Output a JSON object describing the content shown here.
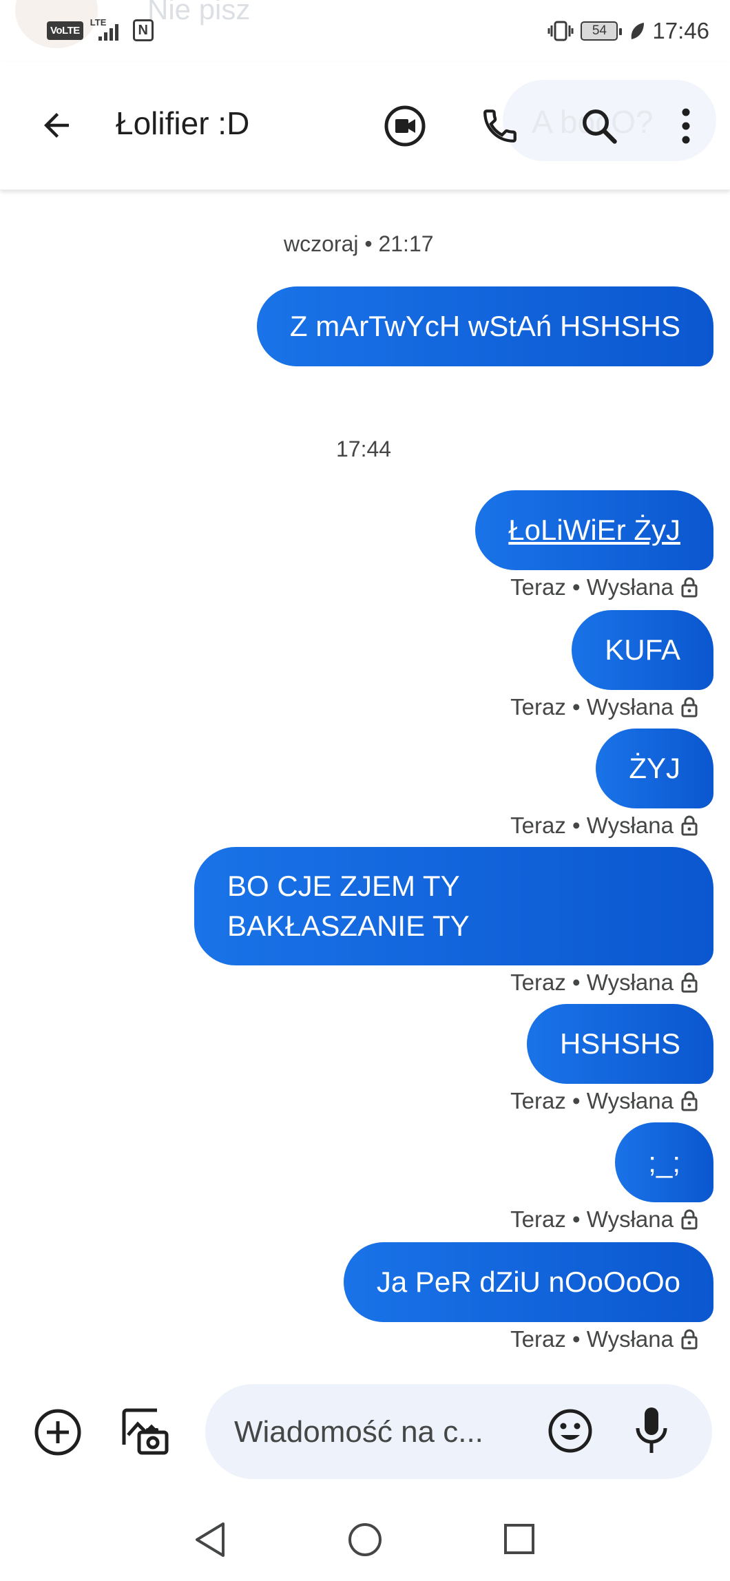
{
  "status_bar": {
    "background_notification_text": "Nie pisz",
    "volte": "VoLTE",
    "lte": "LTE",
    "nfc": "N",
    "battery": "54",
    "time": "17:46"
  },
  "header": {
    "title": "Łolifier :D",
    "background_hint_text": "A bocO?",
    "icons": [
      "arrow-back-icon",
      "video-call-icon",
      "phone-icon",
      "search-icon",
      "more-vert-icon"
    ]
  },
  "conversation": {
    "separators": [
      "wczoraj • 21:17",
      "17:44"
    ],
    "messages": [
      {
        "text": "Z mArTwYcH wStAń HSHSHS",
        "status": ""
      },
      {
        "text": "ŁoLiWiEr ŻyJ",
        "status": "Teraz • Wysłana",
        "link": true
      },
      {
        "text": "KUFA",
        "status": "Teraz • Wysłana"
      },
      {
        "text": "ŻYJ",
        "status": "Teraz • Wysłana"
      },
      {
        "text_line1": "BO CJE ZJEM TY",
        "text_line2": "BAKŁASZANIE TY",
        "status": "Teraz • Wysłana"
      },
      {
        "text": "HSHSHS",
        "status": "Teraz • Wysłana"
      },
      {
        "text": ";_;",
        "status": "Teraz • Wysłana"
      },
      {
        "text": "Ja PeR dZiU nOoOoOo",
        "status": "Teraz • Wysłana"
      }
    ]
  },
  "compose": {
    "placeholder": "Wiadomość na c...",
    "icons": [
      "add-circle-icon",
      "gallery-camera-icon",
      "emoji-icon",
      "microphone-icon"
    ]
  },
  "navigation": {
    "icons": [
      "nav-back-icon",
      "nav-home-icon",
      "nav-recents-icon"
    ]
  },
  "colors": {
    "bubble_start": "#1a73e8",
    "bubble_end": "#0b57d0",
    "compose_bg": "#eef2fa",
    "text_secondary": "#444746"
  }
}
